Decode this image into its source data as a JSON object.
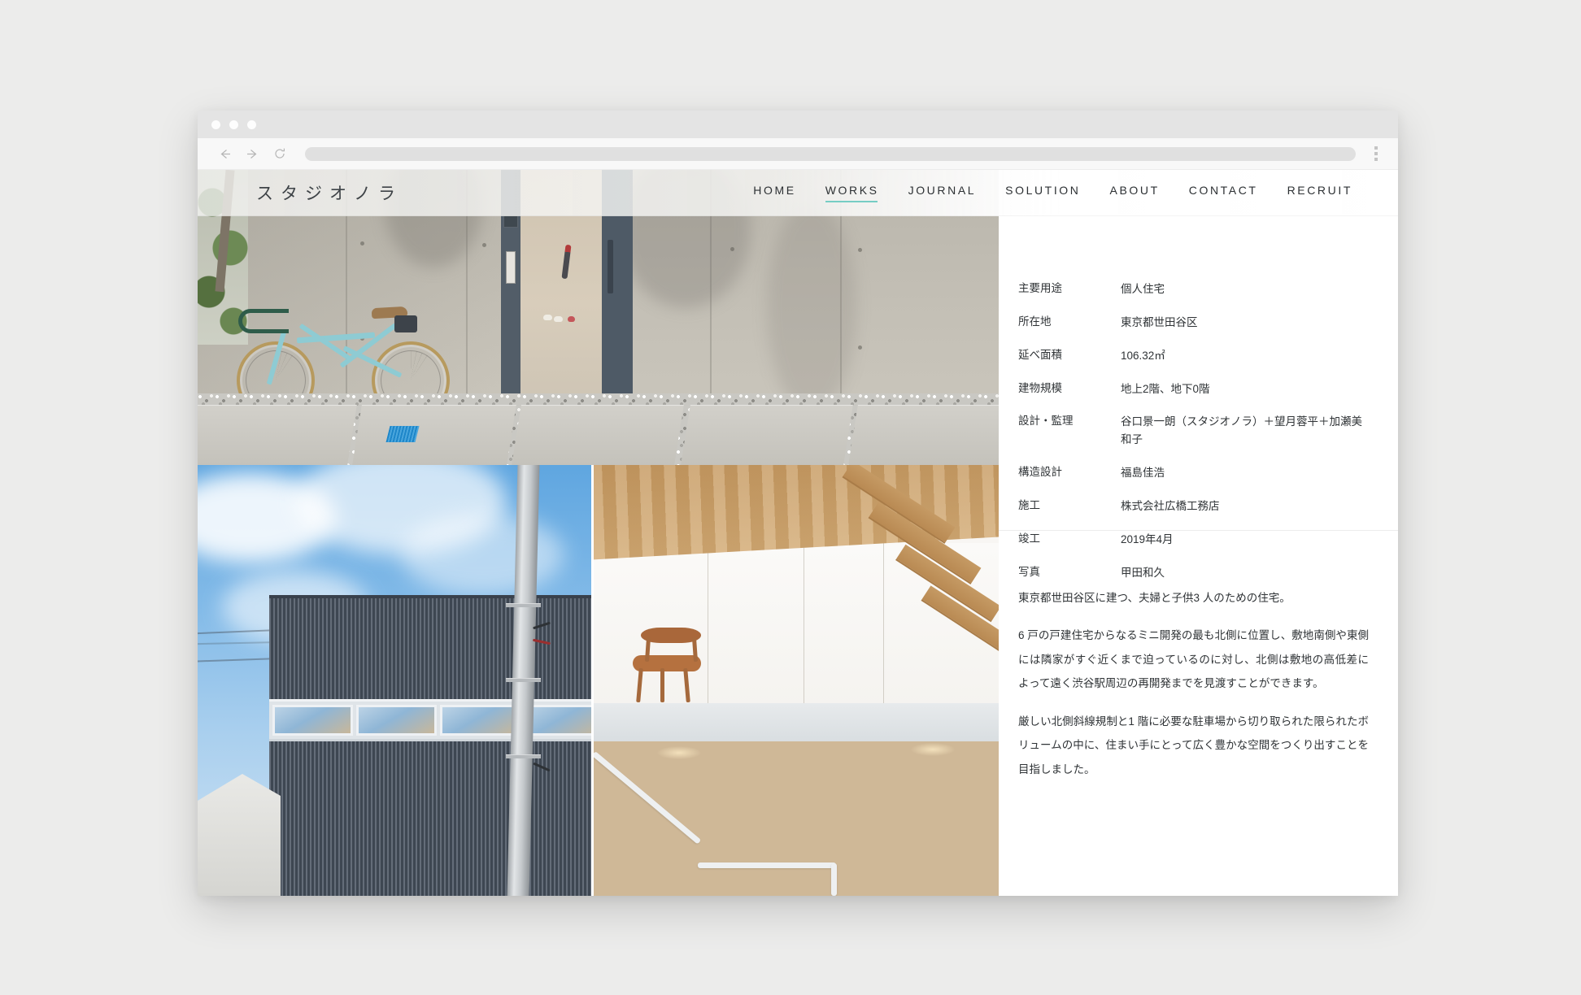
{
  "browser": {
    "traffic_lights": [
      "close",
      "minimize",
      "maximize"
    ],
    "back_icon": "arrow-left-icon",
    "forward_icon": "arrow-right-icon",
    "reload_icon": "reload-icon",
    "menu_icon": "kebab-menu-icon",
    "url_value": "",
    "url_placeholder": ""
  },
  "site": {
    "logo": "スタジオノラ",
    "nav": [
      {
        "label": "HOME",
        "active": false
      },
      {
        "label": "WORKS",
        "active": true
      },
      {
        "label": "JOURNAL",
        "active": false
      },
      {
        "label": "SOLUTION",
        "active": false
      },
      {
        "label": "ABOUT",
        "active": false
      },
      {
        "label": "CONTACT",
        "active": false
      },
      {
        "label": "RECRUIT",
        "active": false
      }
    ],
    "accent_color": "#76cdc4"
  },
  "gallery": {
    "hero": {
      "name": "exterior-entrance-bicycle-photo",
      "description": "水色の自転車がコンクリート打ち放しの壁に立てかけられた住宅のアプローチ、奥に濃灰色の玄関扉"
    },
    "facade": {
      "name": "exterior-facade-photo",
      "description": "青空を背景にした濃灰色の波板外壁と横長の連窓、手前に電柱と電線"
    },
    "interior": {
      "name": "interior-stairwell-photo",
      "description": "木の天井と梁、白い壁、木製の椅子、白い手すりの階段室"
    }
  },
  "spec": {
    "rows": [
      {
        "label": "主要用途",
        "value": "個人住宅"
      },
      {
        "label": "所在地",
        "value": "東京都世田谷区"
      },
      {
        "label": "延べ面積",
        "value": "106.32㎡"
      },
      {
        "label": "建物規模",
        "value": "地上2階、地下0階"
      },
      {
        "label": "設計・監理",
        "value": "谷口景一朗（スタジオノラ）＋望月蓉平＋加瀬美和子"
      },
      {
        "label": "構造設計",
        "value": "福島佳浩"
      },
      {
        "label": "施工",
        "value": "株式会社広橋工務店"
      },
      {
        "label": "竣工",
        "value": "2019年4月"
      },
      {
        "label": "写真",
        "value": "甲田和久"
      }
    ]
  },
  "description": {
    "paragraphs": [
      "東京都世田谷区に建つ、夫婦と子供3 人のための住宅。",
      "6 戸の戸建住宅からなるミニ開発の最も北側に位置し、敷地南側や東側には隣家がすぐ近くまで迫っているのに対し、北側は敷地の高低差によって遠く渋谷駅周辺の再開発までを見渡すことができます。",
      "厳しい北側斜線規制と1 階に必要な駐車場から切り取られた限られたボリュームの中に、住まい手にとって広く豊かな空間をつくり出すことを目指しました。"
    ]
  }
}
